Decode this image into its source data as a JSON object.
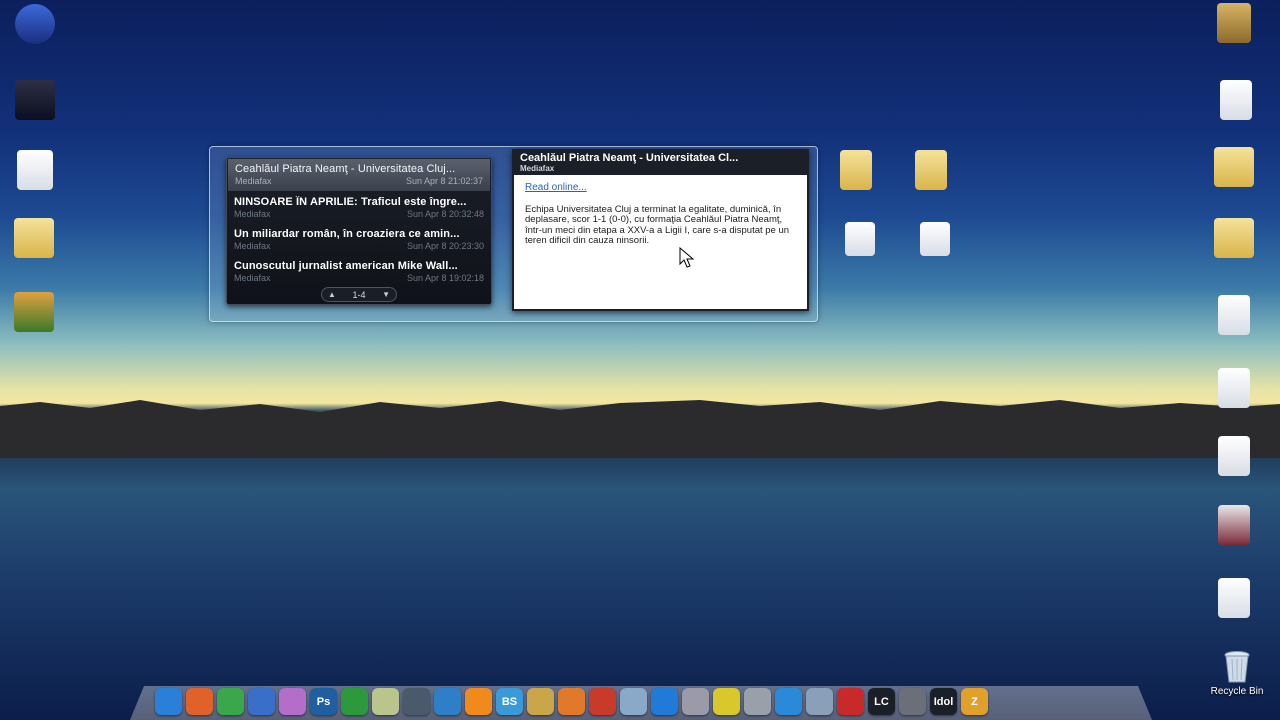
{
  "headlines": [
    {
      "title": "Ceahlăul Piatra Neamţ - Universitatea Cluj...",
      "source": "Mediafax",
      "date": "Sun Apr 8 21:02:37"
    },
    {
      "title": "NINSOARE ÎN APRILIE: Traficul este îngre...",
      "source": "Mediafax",
      "date": "Sun Apr 8 20:32:48"
    },
    {
      "title": "Un miliardar român, în croaziera ce amin...",
      "source": "Mediafax",
      "date": "Sun Apr 8 20:23:30"
    },
    {
      "title": "Cunoscutul jurnalist american Mike Wall...",
      "source": "Mediafax",
      "date": "Sun Apr 8 19:02:18"
    }
  ],
  "pager": {
    "range": "1-4",
    "prev_icon": "triangle-up-icon",
    "next_icon": "triangle-down-icon"
  },
  "article": {
    "title": "Ceahlăul Piatra Neamţ - Universitatea Cl...",
    "source": "Mediafax",
    "link": "Read online...",
    "body": "Echipa Universitatea Cluj a terminat la egalitate, duminică, în deplasare, scor 1-1 (0-0), cu formaţia Ceahlăul Piatra Neamţ, într-un meci din etapa a XXV-a a Ligii I, care s-a disputat pe un teren dificil din cauza ninsorii."
  },
  "desktop": {
    "recycle_bin_label": "Recycle Bin"
  },
  "dock_items": [
    {
      "name": "internet-explorer-icon",
      "label": "",
      "color": "#2a7fd8"
    },
    {
      "name": "firefox-icon",
      "label": "",
      "color": "#e0622a"
    },
    {
      "name": "chrome-icon",
      "label": "",
      "color": "#3aa84a"
    },
    {
      "name": "chart-app-icon",
      "label": "",
      "color": "#3a6fc8"
    },
    {
      "name": "messenger-icon",
      "label": "",
      "color": "#b36ec9"
    },
    {
      "name": "photoshop-icon",
      "label": "Ps",
      "color": "#1f5f9f"
    },
    {
      "name": "utorrent-icon",
      "label": "",
      "color": "#2c9a3c"
    },
    {
      "name": "notes-icon",
      "label": "",
      "color": "#b9c58c"
    },
    {
      "name": "media-icon",
      "label": "",
      "color": "#4b5a6a"
    },
    {
      "name": "ccleaner-icon",
      "label": "",
      "color": "#2f7fc8"
    },
    {
      "name": "vlc-icon",
      "label": "",
      "color": "#f08a1c"
    },
    {
      "name": "bs-player-icon",
      "label": "BS",
      "color": "#3a9ad8"
    },
    {
      "name": "tools-icon",
      "label": "",
      "color": "#c9a64a"
    },
    {
      "name": "video-icon",
      "label": "",
      "color": "#e07a2a"
    },
    {
      "name": "avira-icon",
      "label": "",
      "color": "#c83a2a"
    },
    {
      "name": "search-icon",
      "label": "",
      "color": "#8aa8c8"
    },
    {
      "name": "teamviewer-icon",
      "label": "",
      "color": "#1f7ad8"
    },
    {
      "name": "network-icon",
      "label": "",
      "color": "#9a9aa8"
    },
    {
      "name": "puzzle-icon",
      "label": "",
      "color": "#d8c82a"
    },
    {
      "name": "lock-icon",
      "label": "",
      "color": "#9aa0aa"
    },
    {
      "name": "lightning-icon",
      "label": "",
      "color": "#2a8ad8"
    },
    {
      "name": "folder-icon",
      "label": "",
      "color": "#8aa0b8"
    },
    {
      "name": "car-icon",
      "label": "",
      "color": "#c82a2a"
    },
    {
      "name": "lc-icon",
      "label": "LC",
      "color": "#1b1f28"
    },
    {
      "name": "counter-strike-icon",
      "label": "",
      "color": "#6a6f78"
    },
    {
      "name": "idol-icon",
      "label": "Idol",
      "color": "#1b1f28"
    },
    {
      "name": "z-app-icon",
      "label": "Z",
      "color": "#e0a02a"
    }
  ]
}
